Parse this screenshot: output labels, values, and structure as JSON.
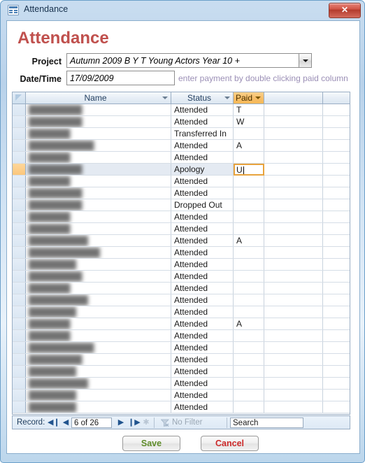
{
  "window": {
    "title": "Attendance",
    "icon": "access-form-icon",
    "close_label": "✕"
  },
  "form": {
    "heading": "Attendance",
    "project_label": "Project",
    "project_value": "Autumn 2009 B Y T Young Actors Year 10 +",
    "date_label": "Date/Time",
    "date_value": "17/09/2009",
    "hint": "enter payment by double clicking paid column"
  },
  "sheet": {
    "columns": [
      "Name",
      "Status",
      "Paid"
    ],
    "selected_row_index": 5,
    "editing": {
      "column": "Paid",
      "value": "U"
    },
    "rows": [
      {
        "name": "",
        "status": "Attended",
        "paid": "T"
      },
      {
        "name": "",
        "status": "Attended",
        "paid": "W"
      },
      {
        "name": "",
        "status": "Transferred In",
        "paid": ""
      },
      {
        "name": "",
        "status": "Attended",
        "paid": "A"
      },
      {
        "name": "",
        "status": "Attended",
        "paid": ""
      },
      {
        "name": "",
        "status": "Apology",
        "paid": "U"
      },
      {
        "name": "",
        "status": "Attended",
        "paid": ""
      },
      {
        "name": "",
        "status": "Attended",
        "paid": ""
      },
      {
        "name": "",
        "status": "Dropped Out",
        "paid": ""
      },
      {
        "name": "",
        "status": "Attended",
        "paid": ""
      },
      {
        "name": "",
        "status": "Attended",
        "paid": ""
      },
      {
        "name": "",
        "status": "Attended",
        "paid": "A"
      },
      {
        "name": "",
        "status": "Attended",
        "paid": ""
      },
      {
        "name": "",
        "status": "Attended",
        "paid": ""
      },
      {
        "name": "",
        "status": "Attended",
        "paid": ""
      },
      {
        "name": "",
        "status": "Attended",
        "paid": ""
      },
      {
        "name": "",
        "status": "Attended",
        "paid": ""
      },
      {
        "name": "",
        "status": "Attended",
        "paid": ""
      },
      {
        "name": "",
        "status": "Attended",
        "paid": "A"
      },
      {
        "name": "",
        "status": "Attended",
        "paid": ""
      },
      {
        "name": "",
        "status": "Attended",
        "paid": ""
      },
      {
        "name": "",
        "status": "Attended",
        "paid": ""
      },
      {
        "name": "",
        "status": "Attended",
        "paid": ""
      },
      {
        "name": "",
        "status": "Attended",
        "paid": ""
      },
      {
        "name": "",
        "status": "Attended",
        "paid": ""
      },
      {
        "name": "",
        "status": "Attended",
        "paid": ""
      }
    ]
  },
  "navigator": {
    "label": "Record:",
    "first_icon": "◀❙",
    "prev_icon": "◀",
    "position": "6 of 26",
    "next_icon": "▶",
    "last_icon": "❙▶",
    "new_icon": "✱",
    "filter_label": "No Filter",
    "search_value": "Search"
  },
  "footer": {
    "save_label": "Save",
    "cancel_label": "Cancel"
  },
  "colors": {
    "heading": "#c0504d",
    "paid_header": "#f6bd68",
    "selection": "#fbc77b",
    "save_text": "#5f8c2a",
    "cancel_text": "#cc2a2a",
    "hint_text": "#9b8fb6"
  }
}
